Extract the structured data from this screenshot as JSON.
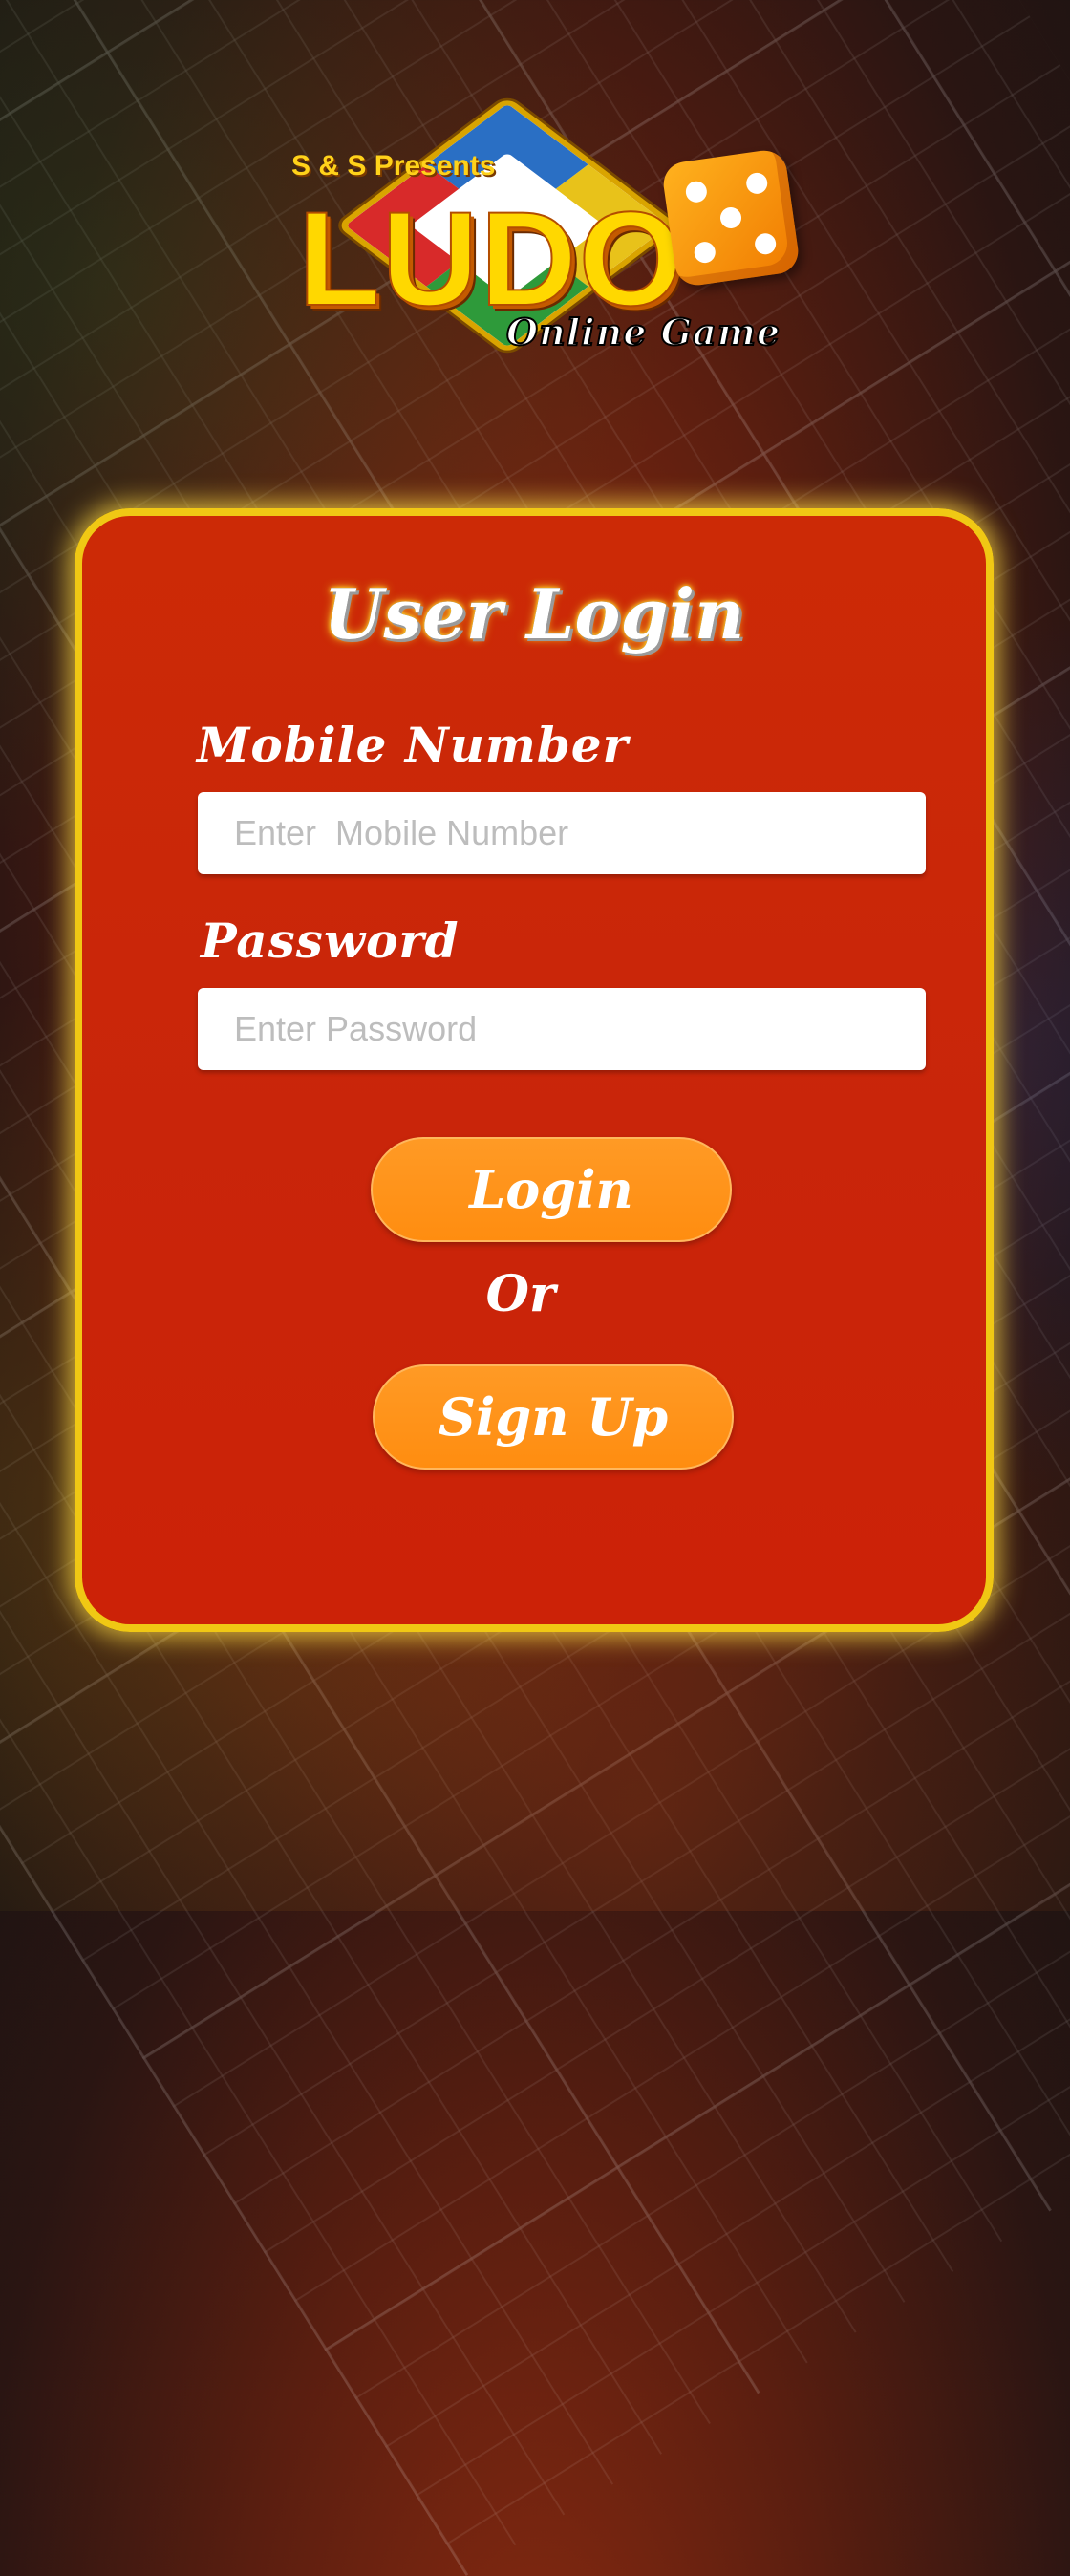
{
  "logo": {
    "presents": "S & S Presents",
    "title": "LUDO",
    "subtitle": "Online Game"
  },
  "login_form": {
    "title": "User Login",
    "mobile_label": "Mobile Number",
    "mobile_placeholder": "Enter  Mobile Number",
    "mobile_value": "",
    "password_label": "Password",
    "password_placeholder": "Enter Password",
    "password_value": "",
    "login_button": "Login",
    "or_text": "Or",
    "signup_button": "Sign Up"
  },
  "colors": {
    "card_red": "#cc2a06",
    "card_border_gold": "#f0c814",
    "button_orange": "#ff8d10",
    "logo_yellow": "#ffd800"
  }
}
